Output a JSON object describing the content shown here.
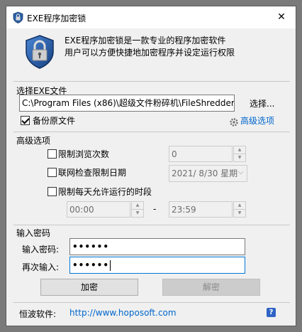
{
  "window": {
    "title": "EXE程序加密锁",
    "close_glyph": "✕"
  },
  "banner": {
    "line1": "EXE程序加密锁是一款专业的程序加密软件",
    "line2": "用户可以方便快捷地加密程序并设定运行权限"
  },
  "file_section": {
    "title": "选择EXE文件",
    "path_value": "C:\\Program Files (x86)\\超级文件粉碎机\\FileShredder.exe",
    "browse_label": "选择...",
    "backup_label": "备份原文件",
    "backup_checked": true,
    "advanced_link": "高级选项"
  },
  "advanced": {
    "title": "高级选项",
    "limit_views_label": "限制浏览次数",
    "limit_views_value": "0",
    "online_date_label": "联网检查限制日期",
    "date_value": "2021/  8/30 星期",
    "time_window_label": "限制每天允许运行的时段",
    "time_from": "00:00",
    "time_separator": "-",
    "time_to": "23:59"
  },
  "password": {
    "title": "输入密码",
    "pwd_label": "输入密码:",
    "pwd_value": "••••••",
    "confirm_label": "再次输入:",
    "confirm_value": "••••••",
    "encrypt_label": "加密",
    "decrypt_label": "解密"
  },
  "footer": {
    "label": "恒波软件:",
    "url": "http://www.hoposoft.com",
    "help_glyph": "?"
  },
  "colors": {
    "link": "#0066cc",
    "focus_border": "#0078d7",
    "help_bg": "#2f63c5"
  }
}
